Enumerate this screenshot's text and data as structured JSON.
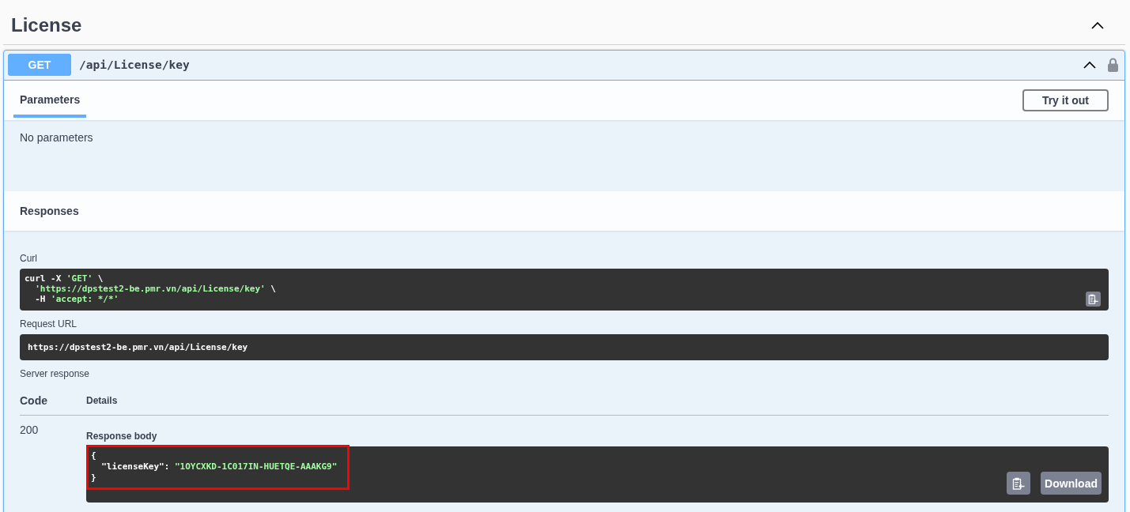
{
  "section": {
    "title": "License",
    "expanded": true
  },
  "operation": {
    "method": "GET",
    "path": "/api/License/key",
    "expanded": true,
    "tabs": [
      {
        "label": "Parameters",
        "selected": true
      }
    ],
    "try_button": "Try it out",
    "parameters_text": "No parameters",
    "responses_title": "Responses",
    "curl": {
      "label": "Curl",
      "lines": [
        [
          {
            "kind": "plain",
            "text": "curl -X "
          },
          {
            "kind": "string",
            "text": "'GET'"
          },
          {
            "kind": "plain",
            "text": " \\"
          }
        ],
        [
          {
            "kind": "string",
            "text": "  'https://dpstest2-be.pmr.vn/api/License/key'"
          },
          {
            "kind": "plain",
            "text": " \\"
          }
        ],
        [
          {
            "kind": "plain",
            "text": "  -H "
          },
          {
            "kind": "string",
            "text": "'accept: */*'"
          }
        ]
      ]
    },
    "request_url": {
      "label": "Request URL",
      "value": "https://dpstest2-be.pmr.vn/api/License/key"
    },
    "server_response": {
      "label": "Server response",
      "columns": [
        "Code",
        "Details"
      ],
      "rows": [
        {
          "code": "200",
          "body_label": "Response body",
          "body_lines": [
            [
              {
                "kind": "plain",
                "text": "{"
              }
            ],
            [
              {
                "kind": "plain",
                "text": "  \"licenseKey\": "
              },
              {
                "kind": "string",
                "text": "\"1OYCXKD-1C017IN-HUETQE-AAAKG9\""
              }
            ],
            [
              {
                "kind": "plain",
                "text": "}"
              }
            ]
          ],
          "highlighted": true,
          "download_button": "Download"
        }
      ]
    }
  }
}
